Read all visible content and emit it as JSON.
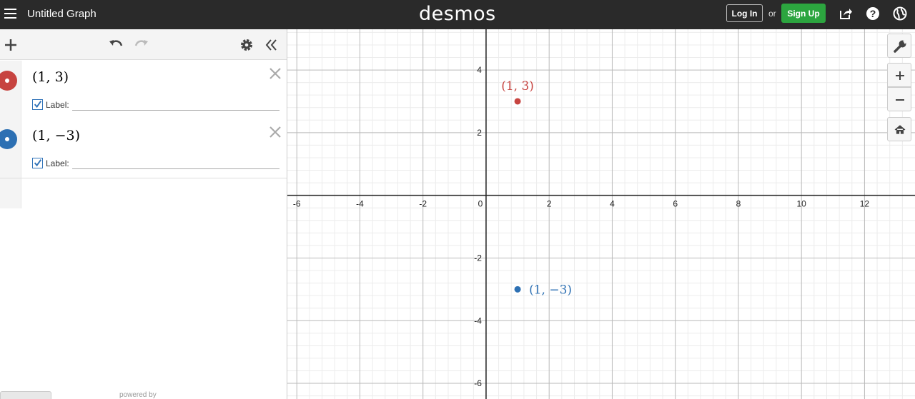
{
  "header": {
    "title": "Untitled Graph",
    "logo": "desmos",
    "login_label": "Log In",
    "or_label": "or",
    "signup_label": "Sign Up",
    "icons": [
      "menu-icon",
      "share-icon",
      "help-icon",
      "globe-icon"
    ]
  },
  "toolbar": {
    "icons": [
      "add-icon",
      "undo-icon",
      "redo-icon",
      "settings-icon",
      "collapse-icon"
    ]
  },
  "expressions": [
    {
      "latex_text": "(1, 3)",
      "color": "#c74440",
      "label_caption": "Label:",
      "label_value": "",
      "label_checked": true
    },
    {
      "latex_text": "(1, −3)",
      "color": "#2d70b3",
      "label_caption": "Label:",
      "label_value": "",
      "label_checked": true
    }
  ],
  "footer": {
    "powered_by": "powered by"
  },
  "graph": {
    "x_range": [
      -6.3,
      13.6
    ],
    "y_range": [
      -6.5,
      5.3
    ],
    "major_step": 2,
    "minor_step": 0.4,
    "x_ticks": [
      -6,
      -4,
      -2,
      0,
      2,
      4,
      6,
      8,
      10,
      12
    ],
    "y_ticks": [
      -6,
      -4,
      -2,
      2,
      4
    ],
    "points": [
      {
        "x": 1,
        "y": 3,
        "label": "(1, 3)",
        "color": "#c74440",
        "label_position": "above"
      },
      {
        "x": 1,
        "y": -3,
        "label": "(1, −3)",
        "color": "#2d70b3",
        "label_position": "right"
      }
    ],
    "controls": [
      "wrench-icon",
      "zoom-in-icon",
      "zoom-out-icon",
      "home-icon"
    ]
  }
}
